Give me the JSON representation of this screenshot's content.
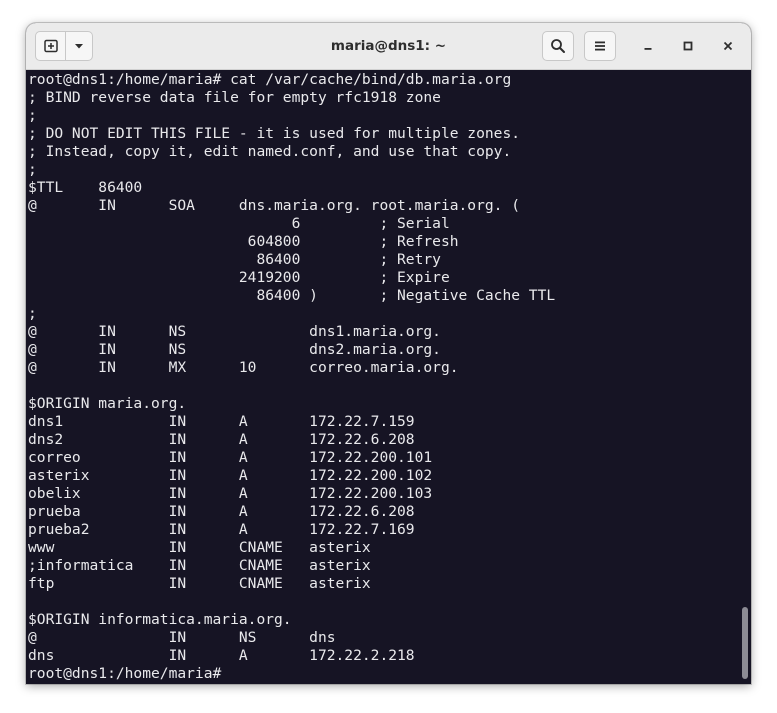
{
  "window": {
    "title": "maria@dns1: ~"
  },
  "colors": {
    "terminal_background": "#161424",
    "terminal_foreground": "#e9e9ec",
    "titlebar_background": "#ebebeb"
  },
  "icons": {
    "new_tab": "new-tab-icon",
    "tab_menu": "chevron-down-icon",
    "search": "search-icon",
    "menu": "hamburger-menu-icon",
    "minimize": "minimize-icon",
    "maximize": "maximize-icon",
    "close": "close-icon"
  },
  "terminal": {
    "lines": [
      "root@dns1:/home/maria# cat /var/cache/bind/db.maria.org",
      "; BIND reverse data file for empty rfc1918 zone",
      ";",
      "; DO NOT EDIT THIS FILE - it is used for multiple zones.",
      "; Instead, copy it, edit named.conf, and use that copy.",
      ";",
      "$TTL    86400",
      "@       IN      SOA     dns.maria.org. root.maria.org. (",
      "                              6         ; Serial",
      "                         604800         ; Refresh",
      "                          86400         ; Retry",
      "                        2419200         ; Expire",
      "                          86400 )       ; Negative Cache TTL",
      ";",
      "@       IN      NS              dns1.maria.org.",
      "@       IN      NS              dns2.maria.org.",
      "@       IN      MX      10      correo.maria.org.",
      "",
      "$ORIGIN maria.org.",
      "dns1            IN      A       172.22.7.159",
      "dns2            IN      A       172.22.6.208",
      "correo          IN      A       172.22.200.101",
      "asterix         IN      A       172.22.200.102",
      "obelix          IN      A       172.22.200.103",
      "prueba          IN      A       172.22.6.208",
      "prueba2         IN      A       172.22.7.169",
      "www             IN      CNAME   asterix",
      ";informatica    IN      CNAME   asterix",
      "ftp             IN      CNAME   asterix",
      "",
      "$ORIGIN informatica.maria.org.",
      "@               IN      NS      dns",
      "dns             IN      A       172.22.2.218"
    ],
    "prompt": "root@dns1:/home/maria# "
  }
}
